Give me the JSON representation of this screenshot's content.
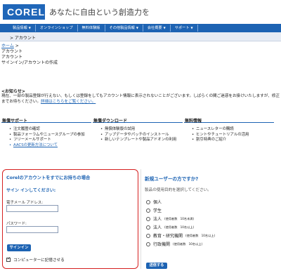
{
  "header": {
    "logo_text": "COREL",
    "tagline": "あなたに自由という創造力を"
  },
  "nav": {
    "items": [
      "製品情報",
      "オンラインショップ",
      "無料体験版",
      "その他製品情報",
      "会社概要",
      "サポート"
    ],
    "arrows": [
      true,
      false,
      false,
      true,
      true,
      true
    ]
  },
  "subnav": {
    "label": "> アカウント"
  },
  "breadcrumb": {
    "home": "ホーム",
    "home_suffix": " >",
    "line2": "アカウント",
    "line3": "アカウント",
    "line4": "サインイン/アカウントの作成"
  },
  "notice": {
    "title": "<お知らせ>",
    "text": "現在、一部の製品登録が行えない、もしくは登録をしてもアカウント情報に表示されないことがございます。しばらくの間ご迷惑をお掛けいたしますが、修正までお待ちください。",
    "link": "詳細はこちらをご覧ください。"
  },
  "columns": [
    {
      "heading": "無償サポート",
      "items": [
        "注文履歴の確認",
        "製品フォーラムやニュースグループの参加",
        "フリーメールサポート",
        "AACSの更新方法について"
      ],
      "link_index": 3
    },
    {
      "heading": "無償ダウンロード",
      "items": [
        "無償体験版の試用",
        "アップデータやパッチのインストール",
        "新しいテンプレートや製品アドオンの利用"
      ],
      "link_index": -1
    },
    {
      "heading": "無料情報",
      "items": [
        "ニュースレターの購読",
        "ヒントやチュートリアルの活用",
        "割引特典のご紹介"
      ],
      "link_index": -1
    }
  ],
  "login": {
    "title": "Corelのアカウントをすでにお持ちの場合",
    "subtitle": "サイン インしてください:",
    "email_label": "電子メール アドレス:",
    "email_value": "",
    "password_label": "パスワード:",
    "password_value": "",
    "signin_button": "サインイン",
    "remember_label": "コンピューターに記憶させる",
    "remember_checked": true
  },
  "new_user": {
    "title": "新規ユーザーの方ですか?",
    "description": "製品の使用目的を選択してください。",
    "options": [
      {
        "label": "個人",
        "note": ""
      },
      {
        "label": "学生",
        "note": ""
      },
      {
        "label": "法人",
        "note": "(使用者数　10名未満)"
      },
      {
        "label": "法人",
        "note": "(使用者数　10名以上)"
      },
      {
        "label": "教育・研究機関",
        "note": "(使用者数　10名以上)"
      },
      {
        "label": "行政機関",
        "note": "(使用者数　10名以上)"
      }
    ],
    "submit_button": "送信する"
  },
  "colors": {
    "brand_blue": "#1d63b3",
    "highlight_red": "#d52020"
  }
}
